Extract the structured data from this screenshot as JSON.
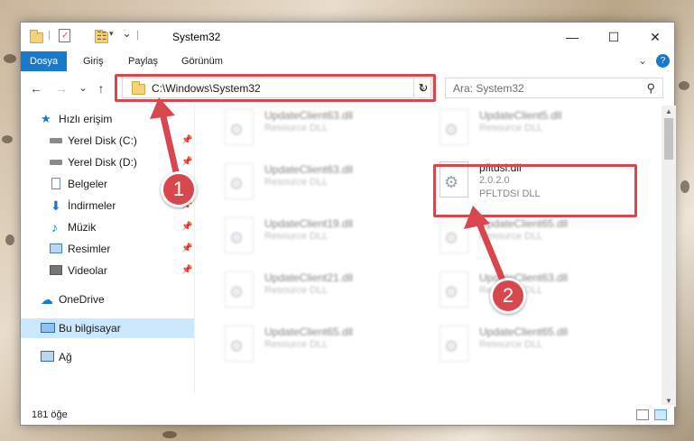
{
  "window": {
    "title": "System32"
  },
  "window_controls": {
    "minimize": "—",
    "maximize": "☐",
    "close": "✕"
  },
  "ribbon": {
    "tabs": [
      {
        "label": "Dosya"
      },
      {
        "label": "Giriş"
      },
      {
        "label": "Paylaş"
      },
      {
        "label": "Görünüm"
      }
    ]
  },
  "nav": {
    "back": "←",
    "forward": "→",
    "recent": "⌄",
    "up": "↑"
  },
  "address": {
    "path": "C:\\Windows\\System32",
    "dropdown": "⌄",
    "refresh": "↻"
  },
  "search": {
    "placeholder": "Ara: System32"
  },
  "sidebar": {
    "items": [
      {
        "label": "Hızlı erişim",
        "icon": "star-icon",
        "pinned": false
      },
      {
        "label": "Yerel Disk (C:)",
        "icon": "drive-icon",
        "pinned": true
      },
      {
        "label": "Yerel Disk (D:)",
        "icon": "drive-icon",
        "pinned": true
      },
      {
        "label": "Belgeler",
        "icon": "documents-icon",
        "pinned": true
      },
      {
        "label": "İndirmeler",
        "icon": "download-icon",
        "pinned": true
      },
      {
        "label": "Müzik",
        "icon": "music-icon",
        "pinned": true
      },
      {
        "label": "Resimler",
        "icon": "pictures-icon",
        "pinned": true
      },
      {
        "label": "Videolar",
        "icon": "videos-icon",
        "pinned": true
      },
      {
        "label": "OneDrive",
        "icon": "cloud-icon",
        "pinned": false
      },
      {
        "label": "Bu bilgisayar",
        "icon": "computer-icon",
        "pinned": false,
        "selected": true
      },
      {
        "label": "Ağ",
        "icon": "network-icon",
        "pinned": false
      }
    ]
  },
  "files": [
    {
      "name": "UpdateClient63.dll",
      "sub1": "Resource DLL",
      "sub2": ""
    },
    {
      "name": "UpdateClient5.dll",
      "sub1": "Resource DLL",
      "sub2": ""
    },
    {
      "name": "UpdateClient63.dll",
      "sub1": "Resource DLL",
      "sub2": ""
    },
    {
      "name": "pfltdsi.dll",
      "sub1": "2.0.2.0",
      "sub2": "PFLTDSI DLL"
    },
    {
      "name": "UpdateClient19.dll",
      "sub1": "Resource DLL",
      "sub2": ""
    },
    {
      "name": "UpdateClient65.dll",
      "sub1": "Resource DLL",
      "sub2": ""
    },
    {
      "name": "UpdateClient21.dll",
      "sub1": "Resource DLL",
      "sub2": ""
    },
    {
      "name": "UpdateClient63.dll",
      "sub1": "Resource DLL",
      "sub2": ""
    },
    {
      "name": "UpdateClient65.dll",
      "sub1": "Resource DLL",
      "sub2": ""
    },
    {
      "name": "UpdateClient65.dll",
      "sub1": "Resource DLL",
      "sub2": ""
    }
  ],
  "status": {
    "item_count": "181 öğe"
  },
  "annotations": {
    "step1": "1",
    "step2": "2"
  },
  "colors": {
    "accent": "#1979ca",
    "highlight": "#d9474e",
    "selection": "#cce8ff"
  }
}
